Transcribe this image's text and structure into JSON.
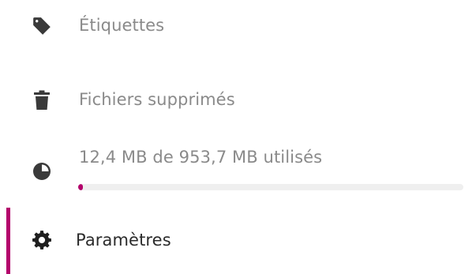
{
  "sidebar": {
    "items": [
      {
        "id": "tags",
        "label": "Étiquettes",
        "icon": "tag-icon"
      },
      {
        "id": "trash",
        "label": "Fichiers supprimés",
        "icon": "trash-icon"
      },
      {
        "id": "settings",
        "label": "Paramètres",
        "icon": "gear-icon",
        "active": true
      }
    ],
    "quota": {
      "label": "12,4 MB de 953,7 MB utilisés",
      "icon": "pie-chart-icon",
      "used_mb": 12.4,
      "total_mb": 953.7
    }
  },
  "colors": {
    "accent": "#b3006b",
    "icon": "#3a3a3a",
    "muted_text": "#8a8a8a",
    "active_text": "#2b2b2b",
    "track": "#efefef"
  }
}
